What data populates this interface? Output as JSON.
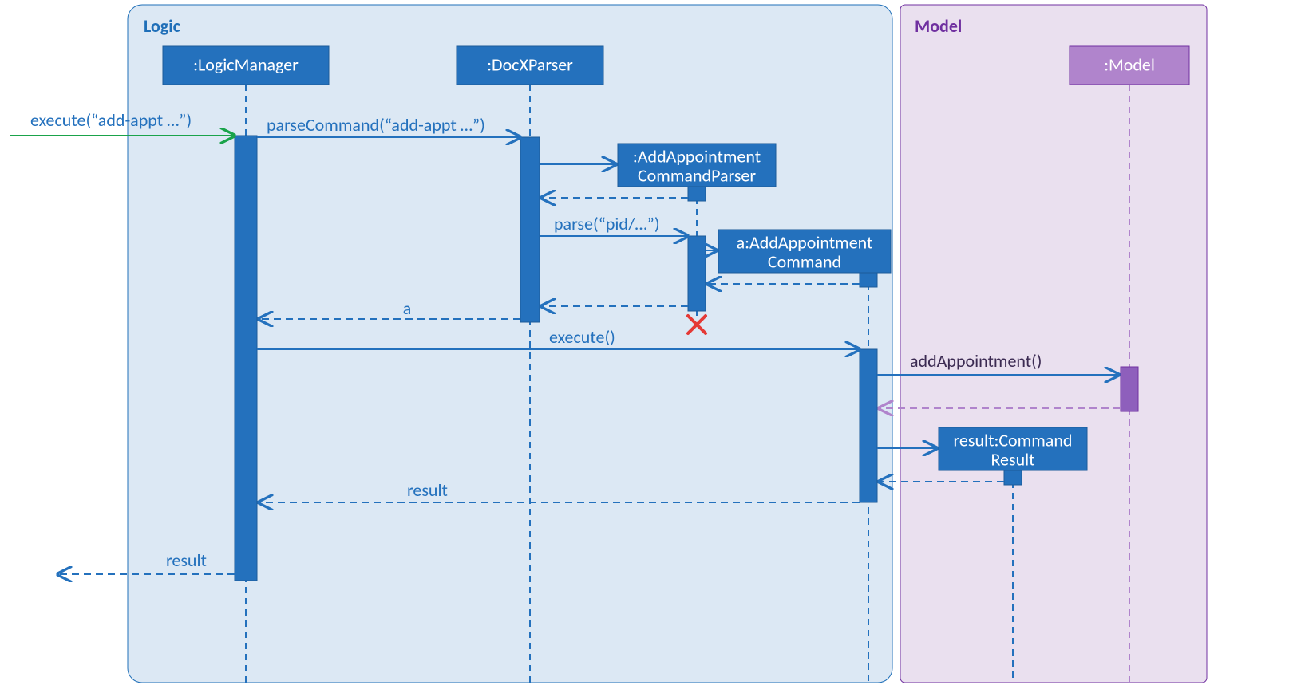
{
  "diagram_type": "uml-sequence",
  "frames": {
    "logic": {
      "title": "Logic"
    },
    "model": {
      "title": "Model"
    }
  },
  "lifelines": {
    "logicManager": ":LogicManager",
    "docXParser": ":DocXParser",
    "addApptCmdParser": ":AddAppointment\nCommandParser",
    "addApptCmd": "a:AddAppointment\nCommand",
    "commandResult": "result:Command\nResult",
    "model": ":Model"
  },
  "messages": {
    "entry": "execute(“add-appt …”)",
    "parseCommand": "parseCommand(“add-appt …”)",
    "parse": "parse(“pid/…”)",
    "returnA": "a",
    "execute": "execute()",
    "addAppointment": "addAppointment()",
    "returnResultToLM": "result",
    "returnResultOut": "result"
  }
}
